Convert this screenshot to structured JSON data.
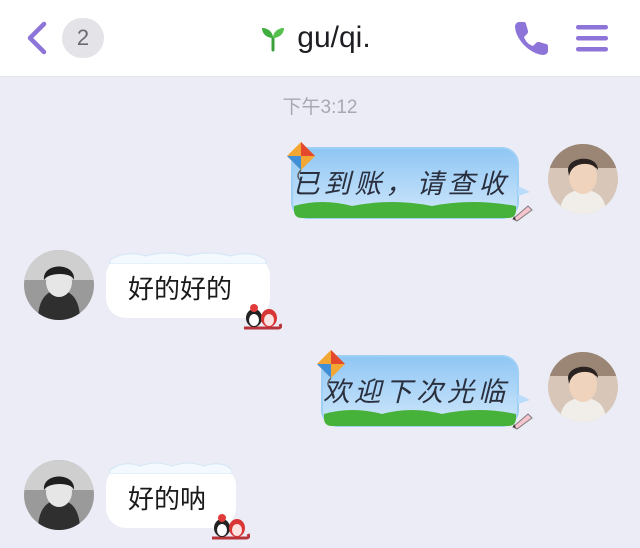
{
  "header": {
    "back_icon": "chevron-left-icon",
    "unread_count": "2",
    "title_icon": "sprout-icon",
    "title": "gu/qi.",
    "call_icon": "phone-icon",
    "menu_icon": "menu-icon"
  },
  "conversation": {
    "timestamp": "下午3:12",
    "messages": [
      {
        "direction": "outgoing",
        "text": "已到账，请查收",
        "bubble": "sky-kite"
      },
      {
        "direction": "incoming",
        "text": "好的好的",
        "bubble": "snow-penguin"
      },
      {
        "direction": "outgoing",
        "text": "欢迎下次光临",
        "bubble": "sky-kite"
      },
      {
        "direction": "incoming",
        "text": "好的呐",
        "bubble": "snow-penguin"
      }
    ]
  },
  "colors": {
    "accent": "#8d74d8",
    "background": "#ebecf6",
    "sky_top": "#8fc6f4",
    "sky_bottom": "#bfe0fb",
    "grass": "#47b23a"
  }
}
